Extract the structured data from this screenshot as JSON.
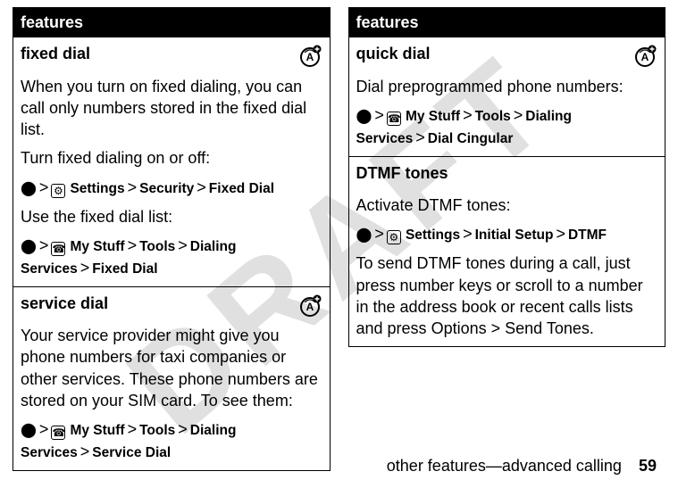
{
  "watermark": "DRAFT",
  "left": {
    "header": "features",
    "rows": [
      {
        "title": "fixed dial",
        "has_badge": true,
        "blocks": [
          {
            "type": "text",
            "value": "When you turn on fixed dialing, you can call only numbers stored in the fixed dial list."
          },
          {
            "type": "text",
            "value": "Turn fixed dialing on or off:"
          },
          {
            "type": "nav",
            "segments": [
              "•",
              "⌂",
              "Settings",
              ">",
              "Security",
              ">",
              "Fixed Dial"
            ]
          },
          {
            "type": "text",
            "value": "Use the fixed dial list:"
          },
          {
            "type": "nav",
            "segments": [
              "•",
              "☎",
              "My Stuff",
              ">",
              "Tools",
              ">",
              "Dialing Services",
              ">",
              "Fixed Dial"
            ]
          }
        ]
      },
      {
        "title": "service dial",
        "has_badge": true,
        "blocks": [
          {
            "type": "text",
            "value": "Your service provider might give you phone numbers for taxi companies or other services. These phone numbers are stored on your SIM card. To see them:"
          },
          {
            "type": "nav",
            "segments": [
              "•",
              "☎",
              "My Stuff",
              ">",
              "Tools",
              ">",
              "Dialing Services",
              ">",
              "Service Dial"
            ]
          }
        ]
      }
    ]
  },
  "right": {
    "header": "features",
    "rows": [
      {
        "title": "quick dial",
        "has_badge": true,
        "blocks": [
          {
            "type": "text",
            "value": "Dial preprogrammed phone numbers:"
          },
          {
            "type": "nav",
            "segments": [
              "•",
              "☎",
              "My Stuff",
              ">",
              "Tools",
              ">",
              "Dialing Services",
              ">",
              "Dial Cingular"
            ]
          }
        ]
      },
      {
        "title": "DTMF tones",
        "has_badge": false,
        "blocks": [
          {
            "type": "text",
            "value": "Activate DTMF tones:"
          },
          {
            "type": "nav",
            "segments": [
              "•",
              "⌂",
              "Settings",
              ">",
              "Initial Setup",
              ">",
              "DTMF"
            ]
          },
          {
            "type": "rich",
            "before": "To send DTMF tones during a call, just press number keys or scroll to a number in the address book or recent calls lists and press ",
            "bold1": "Options",
            "mid": " > ",
            "bold2": "Send Tones",
            "after": "."
          }
        ]
      }
    ]
  },
  "footer": {
    "text": "other features—advanced calling",
    "page": "59"
  }
}
